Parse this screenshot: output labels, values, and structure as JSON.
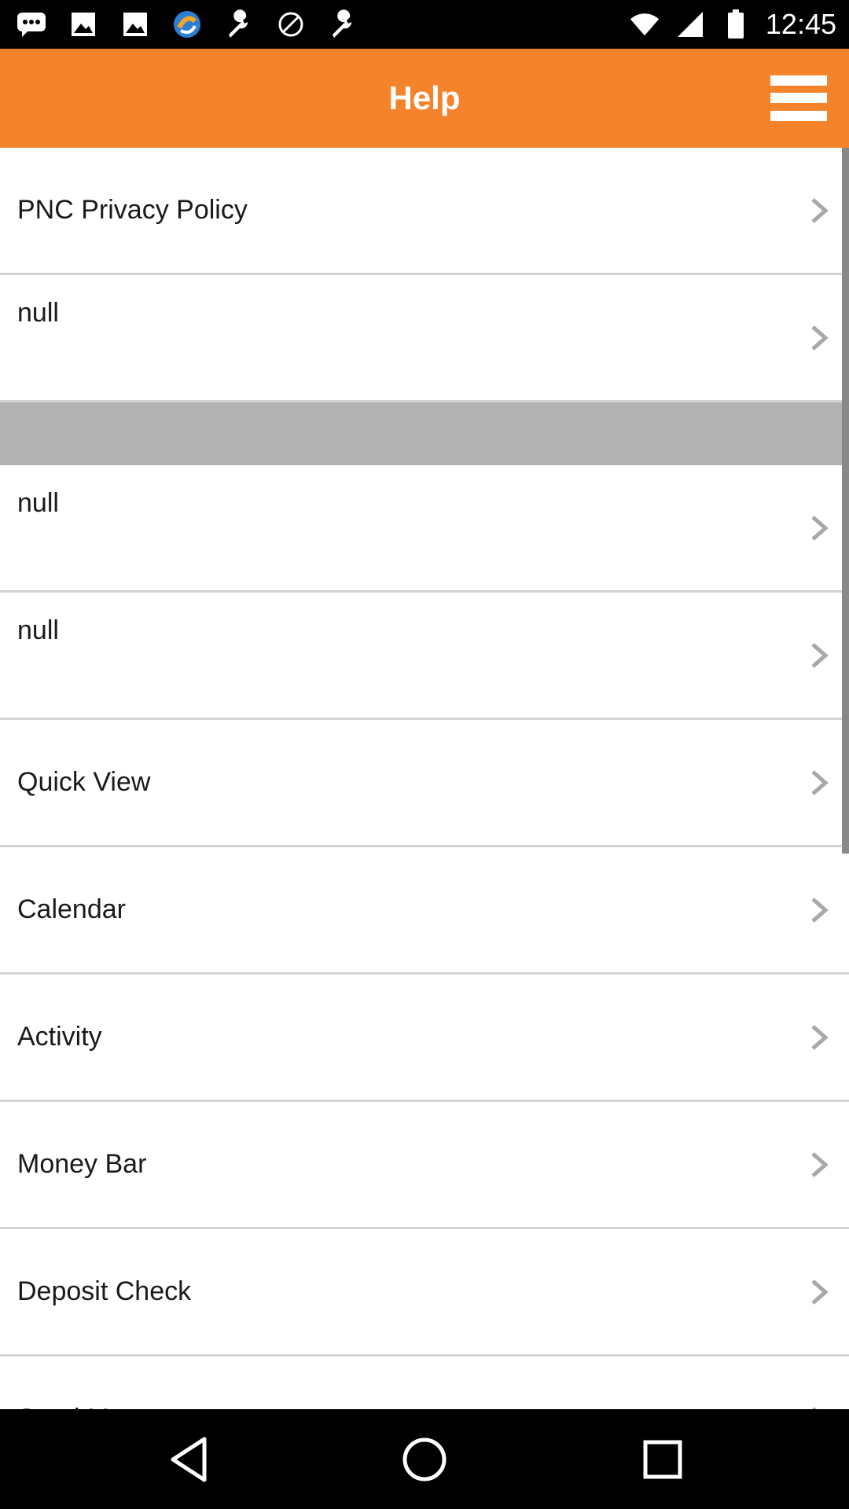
{
  "status_bar": {
    "time": "12:45",
    "left_icons": [
      "chat-bubble-icon",
      "image-icon",
      "image-icon",
      "sync-app-icon",
      "wrench-icon",
      "cancel-circle-icon",
      "wrench-icon"
    ],
    "right_icons": [
      "wifi-icon",
      "signal-icon",
      "battery-icon"
    ]
  },
  "header": {
    "title": "Help",
    "menu_icon": "hamburger-menu-icon",
    "background_color": "#f5832b"
  },
  "list": {
    "items": [
      {
        "label": "PNC Privacy Policy"
      },
      {
        "label": "null"
      },
      {
        "label": "null"
      },
      {
        "label": "null"
      },
      {
        "label": "Quick View"
      },
      {
        "label": "Calendar"
      },
      {
        "label": "Activity"
      },
      {
        "label": "Money Bar"
      },
      {
        "label": "Deposit Check"
      },
      {
        "label": "Send Money"
      }
    ]
  },
  "nav_bar": {
    "buttons": [
      "back-icon",
      "home-icon",
      "recents-icon"
    ]
  }
}
